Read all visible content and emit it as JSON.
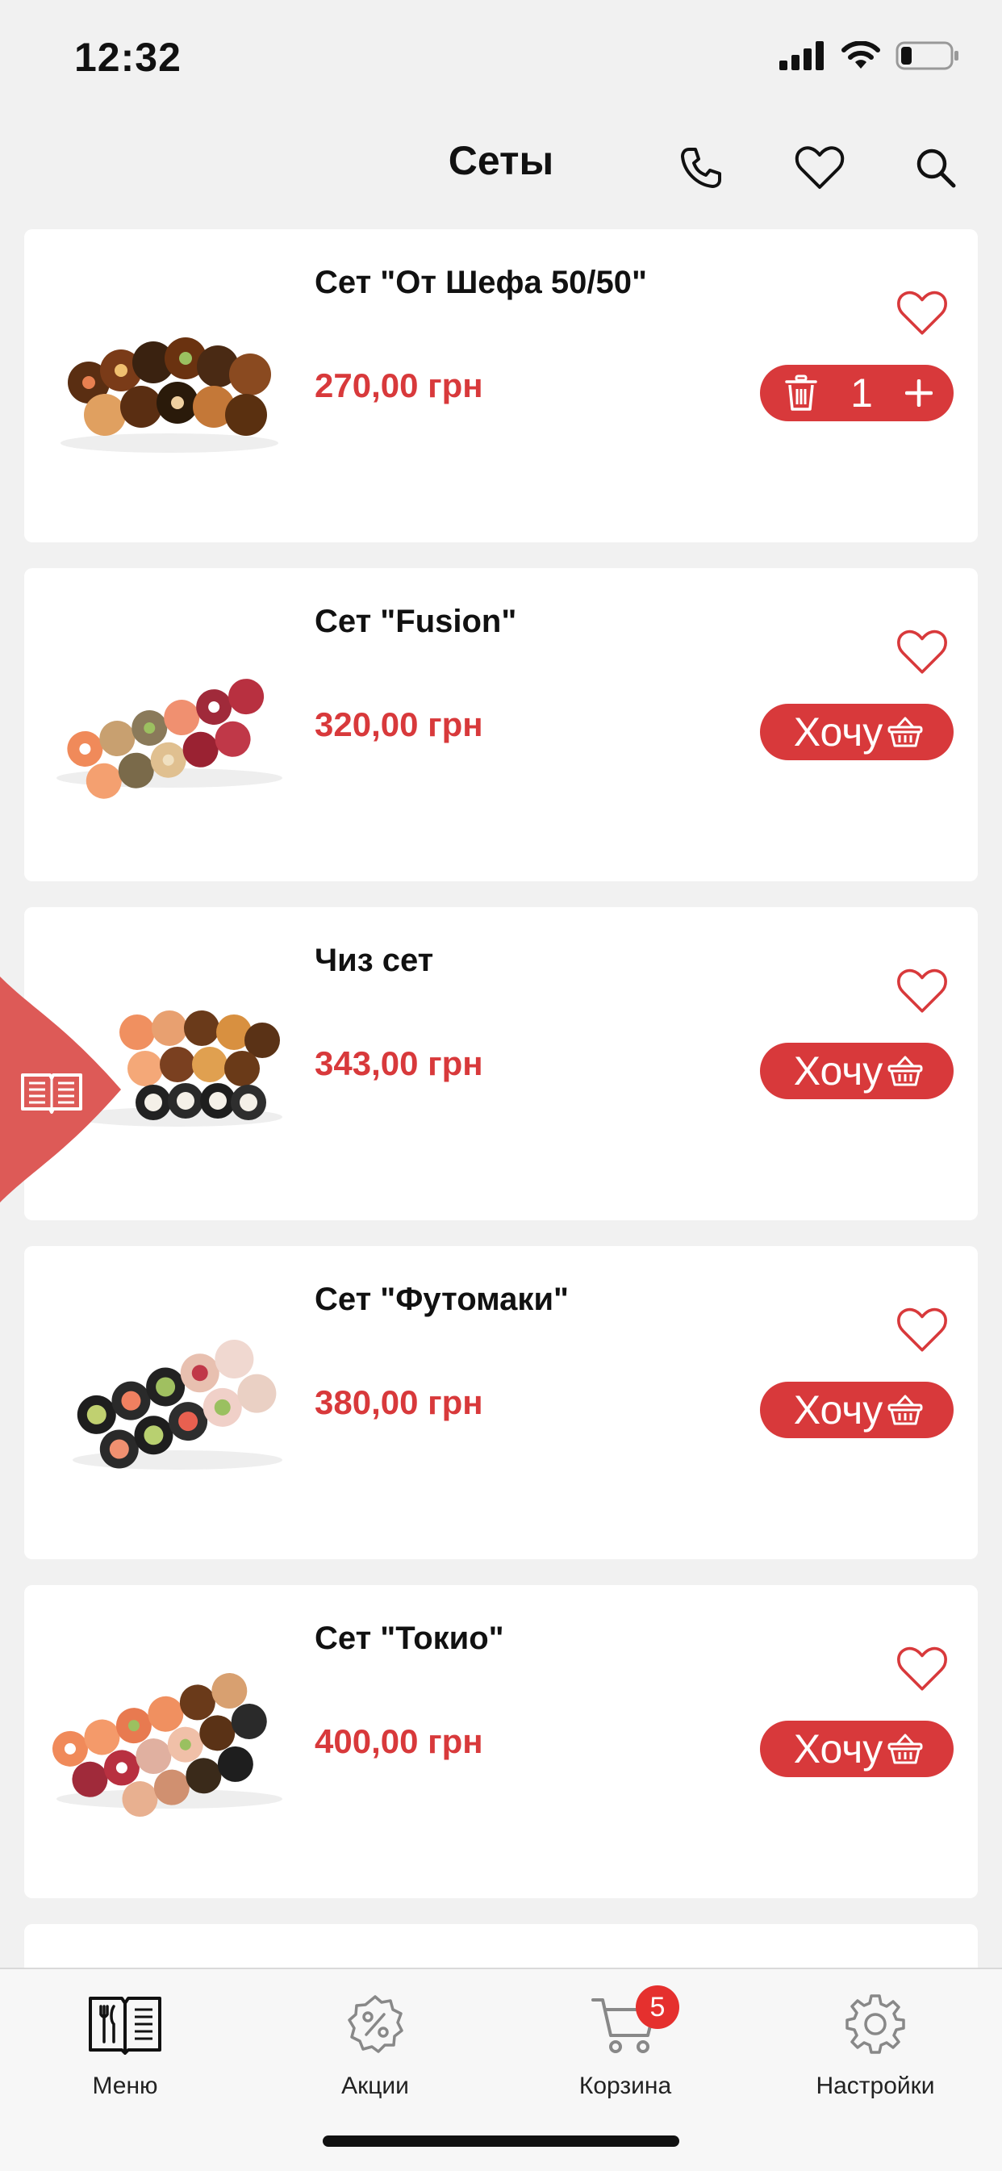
{
  "status_bar": {
    "time": "12:32"
  },
  "header": {
    "title": "Сеты"
  },
  "products": [
    {
      "name": "Сет \"От Шефа 50/50\"",
      "price": "270,00 грн",
      "in_cart": true,
      "quantity": "1"
    },
    {
      "name": "Сет \"Fusion\"",
      "price": "320,00 грн",
      "in_cart": false,
      "button_label": "Хочу"
    },
    {
      "name": "Чиз сет",
      "price": "343,00 грн",
      "in_cart": false,
      "button_label": "Хочу"
    },
    {
      "name": "Сет \"Футомаки\"",
      "price": "380,00 грн",
      "in_cart": false,
      "button_label": "Хочу"
    },
    {
      "name": "Сет \"Токио\"",
      "price": "400,00 грн",
      "in_cart": false,
      "button_label": "Хочу"
    }
  ],
  "tab_bar": {
    "items": [
      {
        "label": "Меню",
        "icon": "menu-book-icon",
        "active": true
      },
      {
        "label": "Акции",
        "icon": "discount-icon"
      },
      {
        "label": "Корзина",
        "icon": "cart-icon",
        "badge": "5"
      },
      {
        "label": "Настройки",
        "icon": "gear-icon"
      }
    ]
  },
  "colors": {
    "accent": "#d8393b",
    "background": "#f1f1f1",
    "card": "#ffffff",
    "badge": "#e5302e"
  }
}
